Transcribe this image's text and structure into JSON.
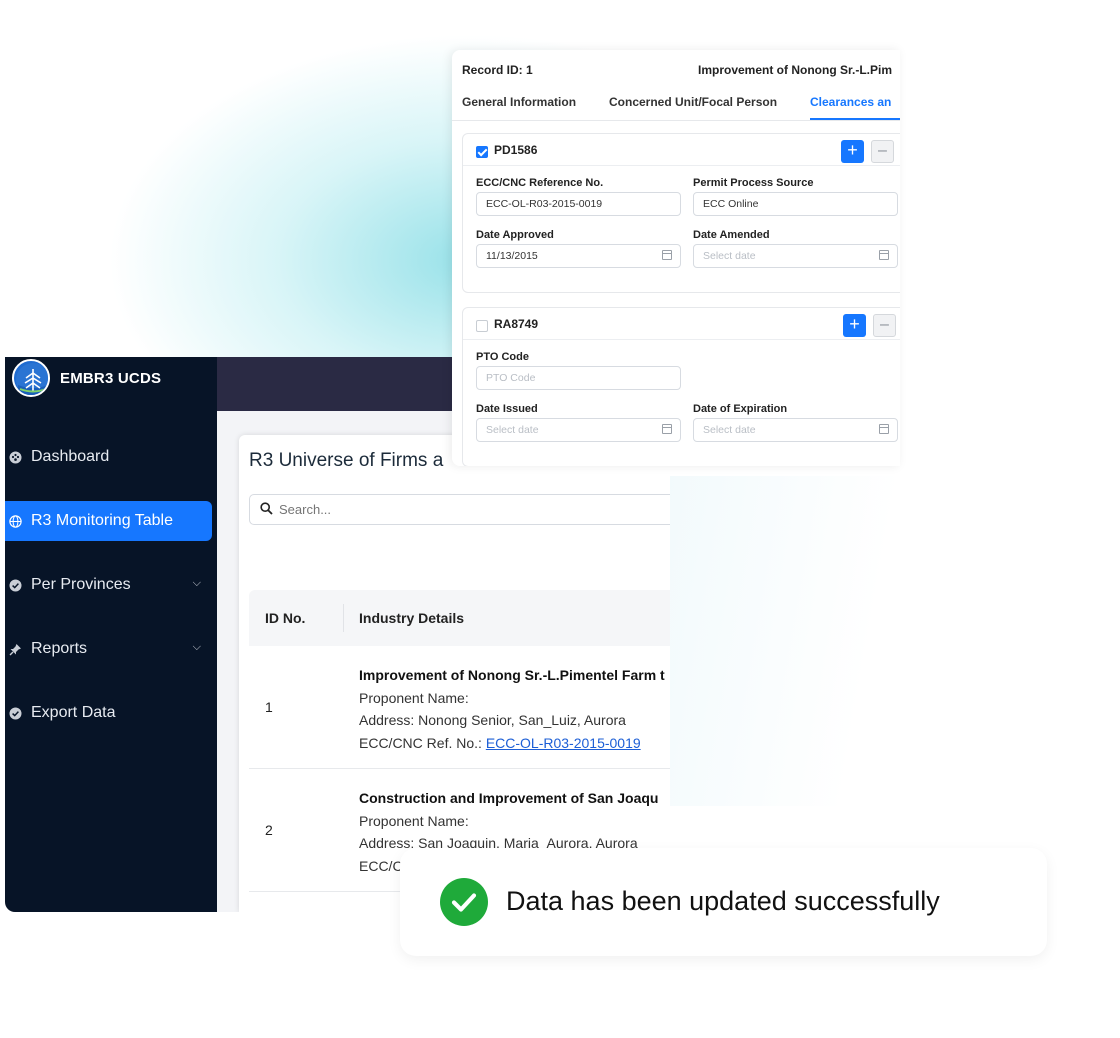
{
  "app": {
    "name": "EMBR3 UCDS"
  },
  "sidebar": {
    "items": [
      {
        "label": "Dashboard",
        "icon": "dashboard-icon"
      },
      {
        "label": "R3 Monitoring Table",
        "icon": "globe-icon",
        "active": true
      },
      {
        "label": "Per Provinces",
        "icon": "check-circle-icon",
        "has_submenu": true
      },
      {
        "label": "Reports",
        "icon": "pin-icon",
        "has_submenu": true
      },
      {
        "label": "Export Data",
        "icon": "check-circle-icon"
      }
    ]
  },
  "main": {
    "title": "R3 Universe of Firms a",
    "search_placeholder": "Search...",
    "table": {
      "columns": [
        "ID No.",
        "Industry Details"
      ],
      "rows": [
        {
          "id": "1",
          "project": "Improvement of Nonong Sr.-L.Pimentel Farm t",
          "proponent": "Proponent Name:",
          "address": "Address: Nonong Senior, San_Luiz, Aurora",
          "ref_label": "ECC/CNC Ref. No.: ",
          "ref_link": "ECC-OL-R03-2015-0019"
        },
        {
          "id": "2",
          "project": "Construction and Improvement of San Joaqu",
          "proponent": "Proponent Name:",
          "address": "Address: San Joaquin, Maria_Aurora, Aurora",
          "ref_label": "ECC/C"
        }
      ]
    }
  },
  "detail": {
    "record_id": "Record ID: 1",
    "record_name": "Improvement of Nonong Sr.-L.Pim",
    "tabs": [
      "General Information",
      "Concerned Unit/Focal Person",
      "Clearances an"
    ],
    "active_tab": "Clearances an",
    "sections": [
      {
        "title": "PD1586",
        "checked": true,
        "fields": {
          "ref_label": "ECC/CNC Reference No.",
          "ref_value": "ECC-OL-R03-2015-0019",
          "source_label": "Permit Process Source",
          "source_value": "ECC Online",
          "approved_label": "Date Approved",
          "approved_value": "11/13/2015",
          "amended_label": "Date Amended",
          "amended_placeholder": "Select date"
        }
      },
      {
        "title": "RA8749",
        "checked": false,
        "fields": {
          "pto_label": "PTO Code",
          "pto_placeholder": "PTO Code",
          "issued_label": "Date Issued",
          "issued_placeholder": "Select date",
          "expiration_label": "Date of Expiration",
          "expiration_placeholder": "Select date"
        }
      }
    ],
    "add_symbol": "+",
    "remove_symbol": "–"
  },
  "toast": {
    "message": "Data has been updated successfully",
    "icon": "check-circle-icon",
    "color": "#1faa3a"
  },
  "colors": {
    "accent": "#1677ff",
    "sidebar_bg": "#071427",
    "topbar_bg": "#2a2a44",
    "link": "#1d5fd6",
    "success": "#1faa3a"
  }
}
